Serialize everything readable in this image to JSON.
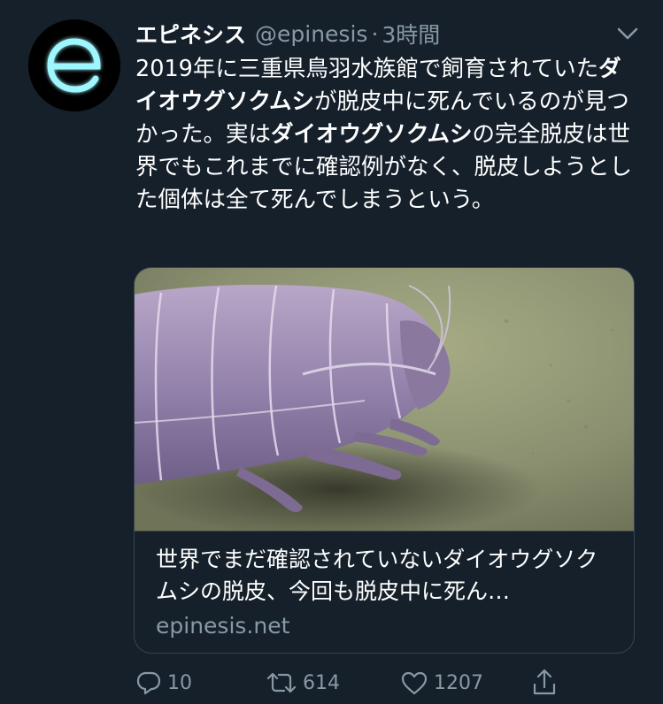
{
  "tweet": {
    "display_name": "エピネシス",
    "handle": "@epinesis",
    "separator": "·",
    "time": "3時間",
    "text_parts": [
      {
        "text": "2019年に三重県鳥羽水族館で飼育されていた",
        "bold": false
      },
      {
        "text": "ダイオウグソクムシ",
        "bold": true
      },
      {
        "text": "が脱皮中に死んでいるのが見つかった。実は",
        "bold": false
      },
      {
        "text": "ダイオウグソクムシ",
        "bold": true
      },
      {
        "text": "の完全脱皮は世界でもこれまでに確認例がなく、脱皮しようとした個体は全て死んでしまうという。",
        "bold": false
      }
    ]
  },
  "avatar": {
    "letter": "e",
    "glow_color": "#8ff3ff"
  },
  "card": {
    "title": "世界でまだ確認されていないダイオウグソクムシの脱皮、今回も脱皮中に死ん…",
    "domain": "epinesis.net"
  },
  "actions": {
    "reply_count": "10",
    "retweet_count": "614",
    "like_count": "1207"
  },
  "icons": {
    "reply": "reply-icon",
    "retweet": "retweet-icon",
    "like": "heart-icon",
    "share": "share-icon",
    "caret": "chevron-down-icon"
  },
  "colors": {
    "background": "#15202b",
    "secondary_text": "#8899a6",
    "border": "#38444d"
  }
}
